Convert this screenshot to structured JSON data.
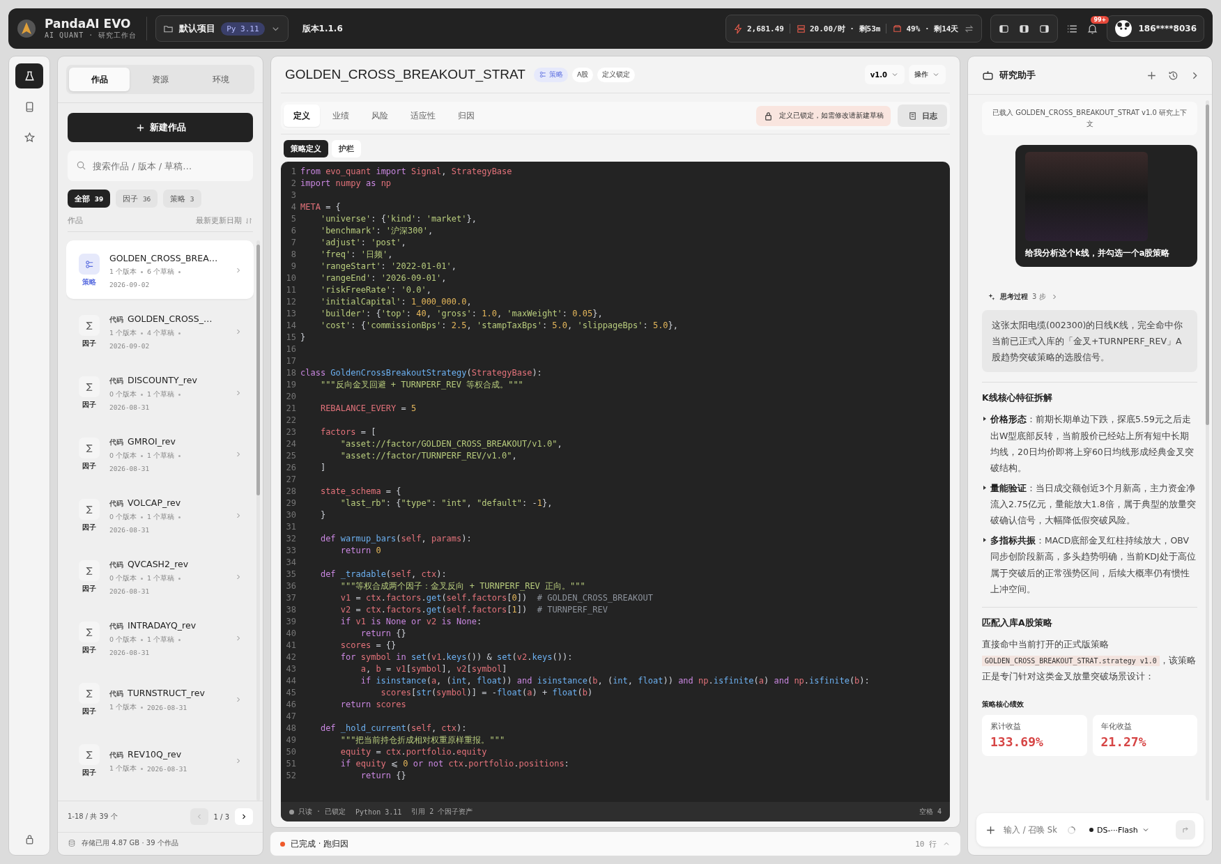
{
  "topbar": {
    "app_name": "PandaAI EVO",
    "app_subtitle": "AI QUANT · 研究工作台",
    "project": "默认项目",
    "python_badge": "Py 3.11",
    "version": "版本1.1.6",
    "stats": [
      {
        "kind": "bolt",
        "text": "2,681.49"
      },
      {
        "kind": "rate",
        "text": "20.00/时 · 剩53m"
      },
      {
        "kind": "disk",
        "text": "49% · 剩14天"
      }
    ],
    "layout_buttons": [
      {
        "kind": "left",
        "selected": false
      },
      {
        "kind": "both",
        "selected": false
      },
      {
        "kind": "right",
        "selected": false
      }
    ],
    "notification_badge": "99+",
    "user": "186****8036"
  },
  "rail": {
    "items": [
      {
        "kind": "flask",
        "selected": true
      },
      {
        "kind": "book",
        "selected": false
      },
      {
        "kind": "star",
        "selected": false
      }
    ]
  },
  "library": {
    "tabs": [
      {
        "label": "作品",
        "selected": true
      },
      {
        "label": "资源",
        "selected": false
      },
      {
        "label": "环境",
        "selected": false
      }
    ],
    "new_button": "新建作品",
    "search": {
      "placeholder": "搜索作品 / 版本 / 草稿…"
    },
    "filters": [
      {
        "label": "全部",
        "count": "39",
        "selected": true
      },
      {
        "label": "因子",
        "count": "36",
        "selected": false
      },
      {
        "label": "策略",
        "count": "3",
        "selected": false
      }
    ],
    "list_header": {
      "left": "作品",
      "right": "最新更新日期"
    },
    "items": [
      {
        "kind": "strategy",
        "type_label": "策略",
        "title": "GOLDEN_CROSS_BREA…",
        "meta": [
          "1 个版本",
          "6 个草稿",
          "2026-09-02"
        ],
        "selected": true
      },
      {
        "kind": "factor",
        "type_label": "因子",
        "tag": "代码",
        "title": "GOLDEN_CROSS_…",
        "meta": [
          "1 个版本",
          "4 个草稿",
          "2026-09-02"
        ],
        "selected": false
      },
      {
        "kind": "factor",
        "type_label": "因子",
        "tag": "代码",
        "title": "DISCOUNTY_rev",
        "meta": [
          "0 个版本",
          "1 个草稿",
          "2026-08-31"
        ],
        "selected": false
      },
      {
        "kind": "factor",
        "type_label": "因子",
        "tag": "代码",
        "title": "GMROI_rev",
        "meta": [
          "0 个版本",
          "1 个草稿",
          "2026-08-31"
        ],
        "selected": false
      },
      {
        "kind": "factor",
        "type_label": "因子",
        "tag": "代码",
        "title": "VOLCAP_rev",
        "meta": [
          "0 个版本",
          "1 个草稿",
          "2026-08-31"
        ],
        "selected": false
      },
      {
        "kind": "factor",
        "type_label": "因子",
        "tag": "代码",
        "title": "QVCASH2_rev",
        "meta": [
          "0 个版本",
          "1 个草稿",
          "2026-08-31"
        ],
        "selected": false
      },
      {
        "kind": "factor",
        "type_label": "因子",
        "tag": "代码",
        "title": "INTRADAYQ_rev",
        "meta": [
          "0 个版本",
          "1 个草稿",
          "2026-08-31"
        ],
        "selected": false
      },
      {
        "kind": "factor",
        "type_label": "因子",
        "tag": "代码",
        "title": "TURNSTRUCT_rev",
        "meta": [
          "1 个版本",
          "2026-08-31"
        ],
        "selected": false
      },
      {
        "kind": "factor",
        "type_label": "因子",
        "tag": "代码",
        "title": "REV10Q_rev",
        "meta": [
          "1 个版本",
          "2026-08-31"
        ],
        "selected": false
      }
    ],
    "range": "1-18 / 共 39 个",
    "page": "1 / 3",
    "storage": "存储已用 4.87 GB · 39 个作品"
  },
  "editor": {
    "title": "GOLDEN_CROSS_BREAKOUT_STRAT",
    "tags": [
      {
        "kind": "strategy",
        "text": "策略"
      },
      {
        "kind": "plain",
        "text": "A股"
      },
      {
        "kind": "plain",
        "text": "定义锁定"
      }
    ],
    "version": "v1.0",
    "actions": "操作",
    "tabs": [
      {
        "label": "定义",
        "selected": true
      },
      {
        "label": "业绩",
        "selected": false
      },
      {
        "label": "风险",
        "selected": false
      },
      {
        "label": "适应性",
        "selected": false
      },
      {
        "label": "归因",
        "selected": false
      }
    ],
    "lock_notice": "定义已锁定，如需修改请新建草稿",
    "log_button": "日志",
    "subtabs": [
      {
        "label": "策略定义",
        "selected": true
      },
      {
        "label": "护栏",
        "selected": false
      }
    ],
    "code": [
      {
        "n": "1",
        "text": "from evo_quant import Signal, StrategyBase"
      },
      {
        "n": "2",
        "text": "import numpy as np"
      },
      {
        "n": "3"
      },
      {
        "n": "4",
        "text": "META = {"
      },
      {
        "n": "5",
        "text": "    'universe': {'kind': 'market'},"
      },
      {
        "n": "6",
        "text": "    'benchmark': '沪深300',"
      },
      {
        "n": "7",
        "text": "    'adjust': 'post',"
      },
      {
        "n": "8",
        "text": "    'freq': '日频',"
      },
      {
        "n": "9",
        "text": "    'rangeStart': '2022-01-01',"
      },
      {
        "n": "10",
        "text": "    'rangeEnd': '2026-09-01',"
      },
      {
        "n": "11",
        "text": "    'riskFreeRate': '0.0',"
      },
      {
        "n": "12",
        "text": "    'initialCapital': 1_000_000.0,"
      },
      {
        "n": "13",
        "text": "    'builder': {'top': 40, 'gross': 1.0, 'maxWeight': 0.05},"
      },
      {
        "n": "14",
        "text": "    'cost': {'commissionBps': 2.5, 'stampTaxBps': 5.0, 'slippageBps': 5.0},"
      },
      {
        "n": "15",
        "text": "}"
      },
      {
        "n": "16"
      },
      {
        "n": "17"
      },
      {
        "n": "18",
        "text": "class GoldenCrossBreakoutStrategy(StrategyBase):"
      },
      {
        "n": "19",
        "text": "    \"\"\"反向金叉回避 + TURNPERF_REV 等权合成。\"\"\""
      },
      {
        "n": "20"
      },
      {
        "n": "21",
        "text": "    REBALANCE_EVERY = 5"
      },
      {
        "n": "22"
      },
      {
        "n": "23",
        "text": "    factors = ["
      },
      {
        "n": "24",
        "text": "        \"asset://factor/GOLDEN_CROSS_BREAKOUT/v1.0\","
      },
      {
        "n": "25",
        "text": "        \"asset://factor/TURNPERF_REV/v1.0\","
      },
      {
        "n": "26",
        "text": "    ]"
      },
      {
        "n": "27"
      },
      {
        "n": "28",
        "text": "    state_schema = {"
      },
      {
        "n": "29",
        "text": "        \"last_rb\": {\"type\": \"int\", \"default\": -1},"
      },
      {
        "n": "30",
        "text": "    }"
      },
      {
        "n": "31"
      },
      {
        "n": "32",
        "text": "    def warmup_bars(self, params):"
      },
      {
        "n": "33",
        "text": "        return 0"
      },
      {
        "n": "34"
      },
      {
        "n": "35",
        "text": "    def _tradable(self, ctx):"
      },
      {
        "n": "36",
        "text": "        \"\"\"等权合成两个因子：金叉反向 + TURNPERF_REV 正向。\"\"\""
      },
      {
        "n": "37",
        "text": "        v1 = ctx.factors.get(self.factors[0])  # GOLDEN_CROSS_BREAKOUT"
      },
      {
        "n": "38",
        "text": "        v2 = ctx.factors.get(self.factors[1])  # TURNPERF_REV"
      },
      {
        "n": "39",
        "text": "        if v1 is None or v2 is None:"
      },
      {
        "n": "40",
        "text": "            return {}"
      },
      {
        "n": "41",
        "text": "        scores = {}"
      },
      {
        "n": "42",
        "text": "        for symbol in set(v1.keys()) & set(v2.keys()):"
      },
      {
        "n": "43",
        "text": "            a, b = v1[symbol], v2[symbol]"
      },
      {
        "n": "44",
        "text": "            if isinstance(a, (int, float)) and isinstance(b, (int, float)) and np.isfinite(a) and np.isfinite(b):"
      },
      {
        "n": "45",
        "text": "                scores[str(symbol)] = -float(a) + float(b)"
      },
      {
        "n": "46",
        "text": "        return scores"
      },
      {
        "n": "47"
      },
      {
        "n": "48",
        "text": "    def _hold_current(self, ctx):"
      },
      {
        "n": "49",
        "text": "        \"\"\"把当前持仓折成相对权重原样重报。\"\"\""
      },
      {
        "n": "50",
        "text": "        equity = ctx.portfolio.equity"
      },
      {
        "n": "51",
        "text": "        if equity ⩽ 0 or not ctx.portfolio.positions:"
      },
      {
        "n": "52",
        "text": "            return {}"
      }
    ],
    "status_left": "只读 · 已锁定",
    "status_lang": "Python 3.11",
    "status_refs": "引用 2 个因子资产",
    "status_indent": "空格 4"
  },
  "run_bar": {
    "status": "已完成 · 跑归因",
    "count": "10 行"
  },
  "assistant": {
    "title": "研究助手",
    "context_note": "已载入 GOLDEN_CROSS_BREAKOUT_STRAT v1.0 研究上下文",
    "user_message": "给我分析这个k线，并勾选一个a股策略",
    "thinking": "思考过程",
    "thinking_steps": "3 步",
    "summary": "这张太阳电缆(002300)的日线K线，完全命中你当前已正式入库的「金叉+TURNPERF_REV」A股趋势突破策略的选股信号。",
    "section1": "K线核心特征拆解",
    "bullets": [
      "**价格形态**：前期长期单边下跌，探底5.59元之后走出W型底部反转，当前股价已经站上所有短中长期均线，20日均价即将上穿60日均线形成经典金叉突破结构。",
      "**量能验证**：当日成交额创近3个月新高，主力资金净流入2.75亿元，量能放大1.8倍，属于典型的放量突破确认信号，大幅降低假突破风险。",
      "**多指标共振**：MACD底部金叉红柱持续放大，OBV同步创阶段新高，多头趋势明确，当前KDJ处于高位属于突破后的正常强势区间，后续大概率仍有惯性上冲空间。"
    ],
    "section2": "匹配入库A股策略",
    "paragraph": [
      {
        "kind": "text",
        "text": "直接命中当前打开的正式版策略"
      },
      {
        "kind": "code",
        "text": "GOLDEN_CROSS_BREAKOUT_STRAT.strategy v1.0"
      },
      {
        "kind": "text",
        "text": "，该策略正是专门针对这类金叉放量突破场景设计："
      }
    ],
    "metrics_title": "策略核心绩效",
    "metrics": [
      {
        "label": "累计收益",
        "value": "133.69%"
      },
      {
        "label": "年化收益",
        "value": "21.27%"
      }
    ],
    "input": {
      "placeholder": "输入 / 召唤 Sk"
    },
    "model": "DS-···Flash"
  }
}
